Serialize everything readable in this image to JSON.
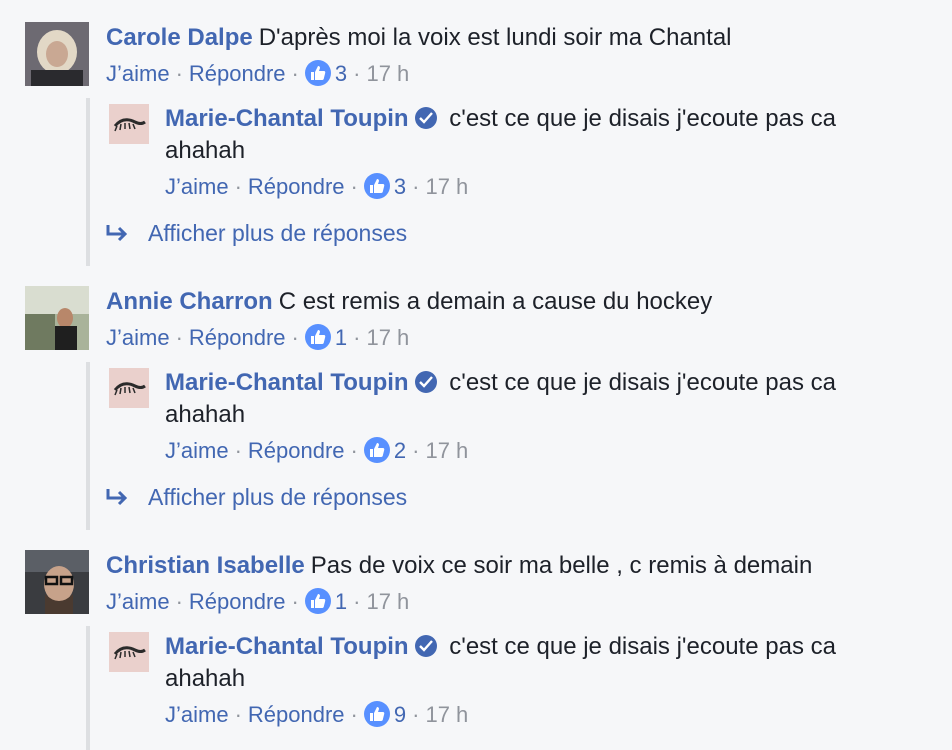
{
  "colors": {
    "link": "#4267b2",
    "muted": "#90949c",
    "like": "#5890ff",
    "background": "#f6f7f9"
  },
  "labels": {
    "like": "J’aime",
    "reply": "Répondre",
    "more_replies": "Afficher plus de réponses"
  },
  "comments": [
    {
      "author": "Carole Dalpe",
      "text": "D'après moi la voix est lundi soir ma Chantal",
      "likes": "3",
      "time": "17 h",
      "reply": {
        "author": "Marie-Chantal Toupin",
        "verified": true,
        "text": "c'est ce que je disais j'ecoute pas ca ahahah",
        "likes": "3",
        "time": "17 h"
      },
      "has_more": true
    },
    {
      "author": "Annie Charron",
      "text": "C est remis a demain a cause du hockey",
      "likes": "1",
      "time": "17 h",
      "reply": {
        "author": "Marie-Chantal Toupin",
        "verified": true,
        "text": "c'est ce que je disais j'ecoute pas ca ahahah",
        "likes": "2",
        "time": "17 h"
      },
      "has_more": true
    },
    {
      "author": "Christian Isabelle",
      "text": "Pas de voix ce soir ma belle , c remis à demain",
      "likes": "1",
      "time": "17 h",
      "reply": {
        "author": "Marie-Chantal Toupin",
        "verified": true,
        "text": "c'est ce que je disais j'ecoute pas ca ahahah",
        "likes": "9",
        "time": "17 h"
      },
      "has_more": false
    }
  ]
}
